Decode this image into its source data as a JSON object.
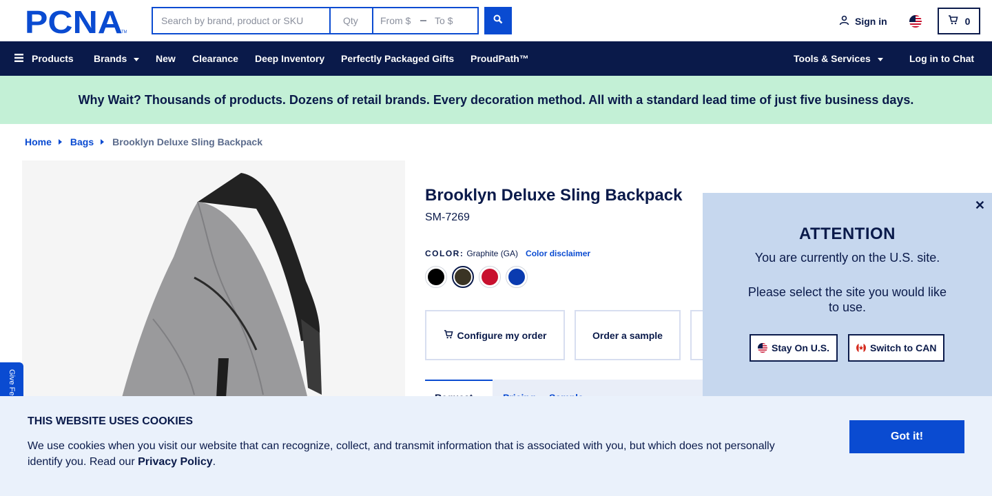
{
  "header": {
    "logo_text": "PCNA",
    "search_placeholder": "Search by brand, product or SKU",
    "qty_placeholder": "Qty",
    "price_from_placeholder": "From $",
    "price_to_placeholder": "To $",
    "sign_in_label": "Sign in",
    "cart_count": "0"
  },
  "nav": {
    "items": [
      {
        "label": "Products"
      },
      {
        "label": "Brands"
      },
      {
        "label": "New"
      },
      {
        "label": "Clearance"
      },
      {
        "label": "Deep Inventory"
      },
      {
        "label": "Perfectly Packaged Gifts"
      },
      {
        "label": "ProudPath™"
      }
    ],
    "tools_label": "Tools & Services",
    "chat_label": "Log in to Chat"
  },
  "promo": {
    "text": "Why Wait? Thousands of products. Dozens of retail brands. Every decoration method. All with a standard lead time of just five business days."
  },
  "breadcrumb": {
    "items": [
      "Home",
      "Bags"
    ],
    "current": "Brooklyn Deluxe Sling Backpack"
  },
  "product": {
    "title": "Brooklyn Deluxe Sling Backpack",
    "sku": "SM-7269",
    "color_label": "COLOR:",
    "color_value": "Graphite (GA)",
    "color_disclaimer": "Color disclaimer",
    "swatches": [
      "#000000",
      "#3a3424",
      "#c8102e",
      "#0a3bb0"
    ],
    "selected_swatch": 1,
    "buttons": {
      "configure": "Configure my order",
      "sample": "Order a sample"
    },
    "tabs": [
      "Request",
      "Pricing",
      "Sample"
    ]
  },
  "attention": {
    "title": "ATTENTION",
    "line1": "You are currently on the U.S. site.",
    "line2": "Please select the site you would like to use.",
    "stay_label": "Stay On U.S.",
    "switch_label": "Switch to CAN"
  },
  "feedback": {
    "label": "Give Feedback"
  },
  "cookie": {
    "title": "THIS WEBSITE USES COOKIES",
    "text": "We use cookies when you visit our website that can recognize, collect, and transmit information that is associated with you, but which does not personally identify you. Read our",
    "link": "Privacy Policy",
    "period": ".",
    "button": "Got it!"
  },
  "colors": {
    "navy": "#0a1a4a",
    "accent_blue": "#0a4bd1",
    "promo_green": "#c3f0d6",
    "popup_bg": "#c6d7ee",
    "cookie_bg": "#eaf1fb"
  }
}
